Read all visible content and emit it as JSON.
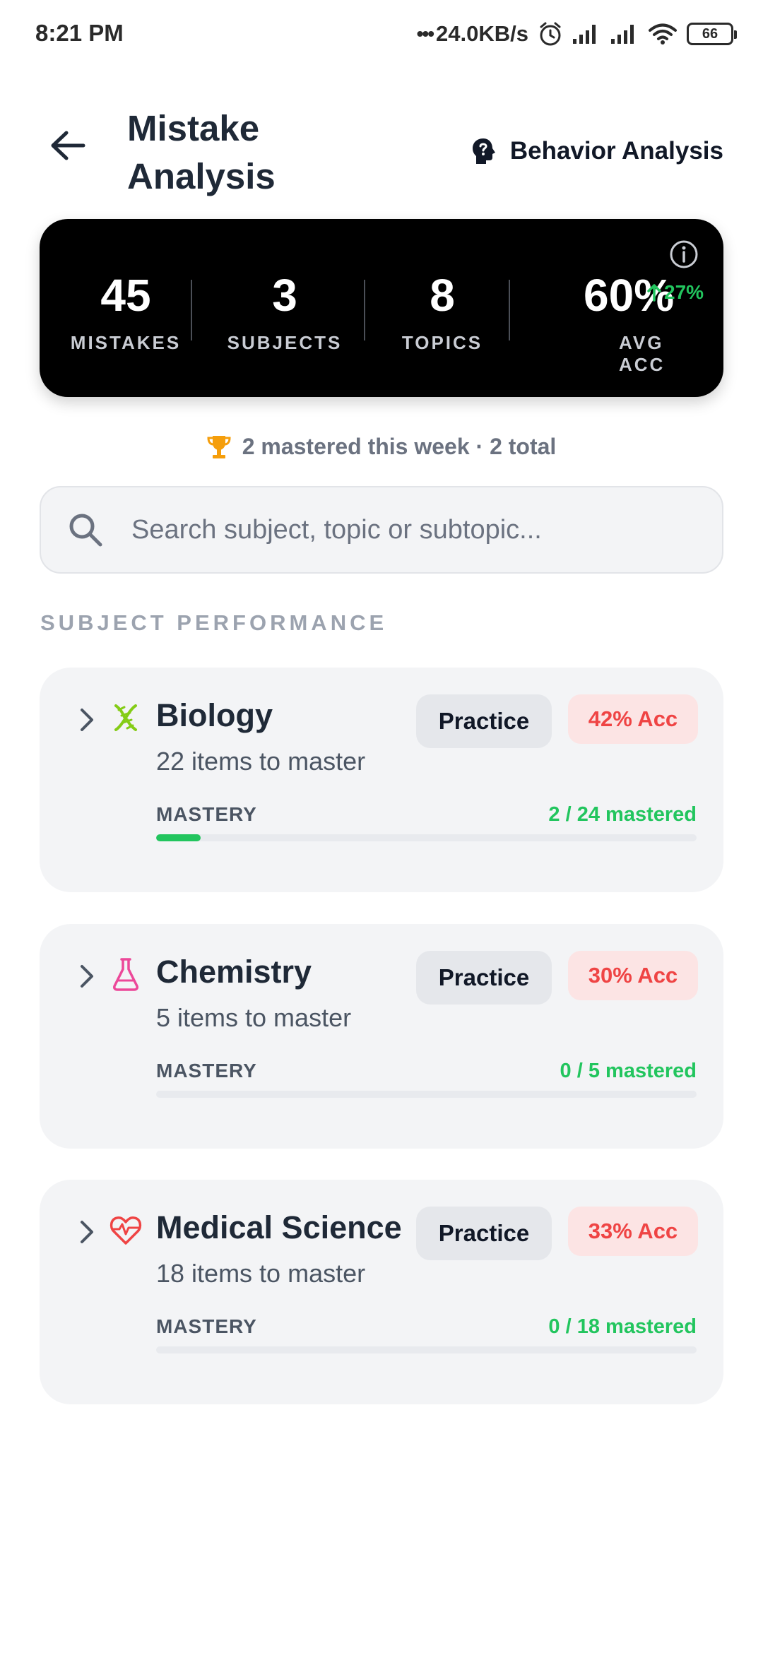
{
  "status_bar": {
    "time": "8:21 PM",
    "dots": "•••",
    "speed": "24.0KB/s",
    "battery": "66",
    "icons": [
      "alarm-icon",
      "signal-icon",
      "signal-icon",
      "wifi-icon",
      "battery-icon"
    ]
  },
  "header": {
    "title": "Mistake Analysis",
    "back_icon": "arrow-left-icon",
    "behavior_label": "Behavior Analysis",
    "behavior_icon": "head-question-icon"
  },
  "stats": {
    "mistakes": {
      "value": "45",
      "label": "MISTAKES"
    },
    "subjects": {
      "value": "3",
      "label": "SUBJECTS"
    },
    "topics": {
      "value": "8",
      "label": "TOPICS"
    },
    "avg_acc": {
      "value": "60%",
      "label": "AVG ACC",
      "trend": "27%",
      "trend_direction": "up"
    },
    "info_icon": "info-icon"
  },
  "mastered_summary": {
    "icon": "trophy-icon",
    "text": "2 mastered this week · 2 total"
  },
  "search": {
    "placeholder": "Search subject, topic or subtopic...",
    "value": "",
    "icon": "search-icon"
  },
  "section_title": "SUBJECT PERFORMANCE",
  "subjects": [
    {
      "name": "Biology",
      "icon": "dna-icon",
      "items_text": "22 items to master",
      "practice_label": "Practice",
      "accuracy": "42% Acc",
      "mastery_label": "MASTERY",
      "mastered_text": "2 / 24 mastered",
      "mastered_fraction": 0.083
    },
    {
      "name": "Chemistry",
      "icon": "flask-icon",
      "items_text": "5 items to master",
      "practice_label": "Practice",
      "accuracy": "30% Acc",
      "mastery_label": "MASTERY",
      "mastered_text": "0 / 5 mastered",
      "mastered_fraction": 0
    },
    {
      "name": "Medical Science",
      "icon": "heartbeat-icon",
      "items_text": "18 items to master",
      "practice_label": "Practice",
      "accuracy": "33% Acc",
      "mastery_label": "MASTERY",
      "mastered_text": "0 / 18 mastered",
      "mastered_fraction": 0
    }
  ],
  "colors": {
    "accent_green": "#22c55e",
    "accuracy_red": "#ef4444",
    "accuracy_bg": "#fce4e4",
    "stats_bg": "#000000",
    "chemistry_icon": "#ec4899",
    "biology_icon": "#84cc16",
    "medical_icon": "#ef4444"
  }
}
